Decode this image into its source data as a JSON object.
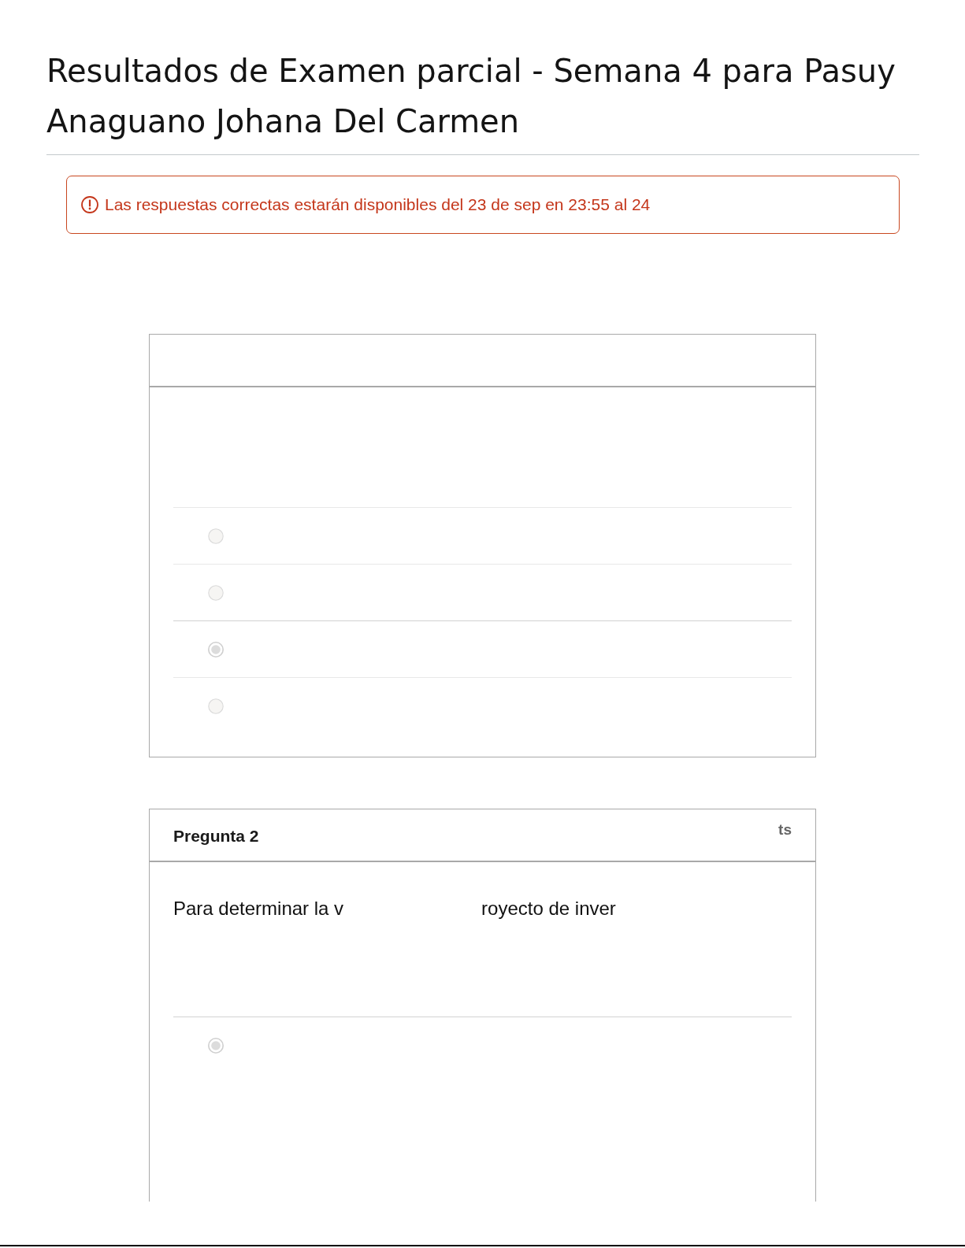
{
  "page": {
    "title": "Resultados de Examen parcial - Semana 4 para Pasuy Anaguano Johana Del Carmen"
  },
  "alert": {
    "message": "Las respuestas correctas estarán disponibles del 23 de sep en 23:55 al 24"
  },
  "questions": [
    {
      "options": [
        {
          "selected": false
        },
        {
          "selected": false
        },
        {
          "selected": true
        },
        {
          "selected": false
        }
      ]
    },
    {
      "title": "Pregunta 2",
      "points": "ts",
      "text_parts": [
        "Para determinar la v",
        "royecto de inver"
      ],
      "options": [
        {
          "selected": true
        }
      ]
    }
  ]
}
